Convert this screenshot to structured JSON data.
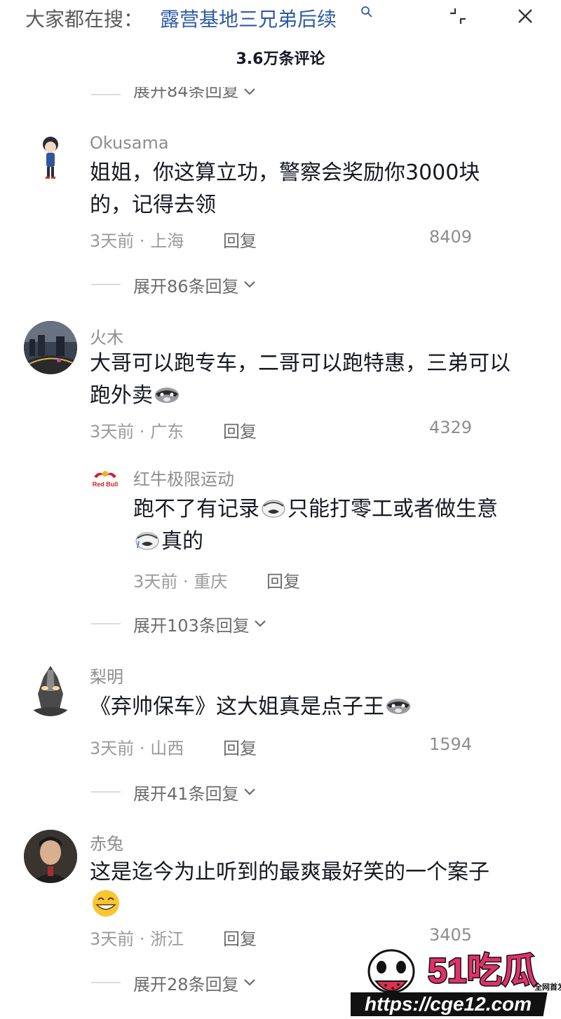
{
  "header": {
    "trend_prefix": "大家都在搜：",
    "trend_query": "露营基地三兄弟后续",
    "search_icon": "search-icon",
    "collapse_icon": "collapse-icon",
    "close_icon": "close-icon"
  },
  "comment_count_title": "3.6万条评论",
  "top_expand": {
    "label": "展开84条回复"
  },
  "comments": [
    {
      "username": "Okusama",
      "avatar": "cartoon-detective-avatar",
      "content_line1": "姐姐，你这算立功，警察会奖励你3000块",
      "content_line2": "的，记得去领",
      "time": "3天前",
      "location": "上海",
      "reply_label": "回复",
      "likes": "8409",
      "expand_label": "展开86条回复"
    },
    {
      "username": "火木",
      "avatar": "night-city-avatar",
      "content_line1": "大哥可以跑专车，二哥可以跑特惠，三弟可以",
      "content_line2": "跑外卖",
      "time": "3天前",
      "location": "广东",
      "reply_label": "回复",
      "likes": "4329",
      "reply": {
        "username": "红牛极限运动",
        "avatar": "redbull-logo-avatar",
        "logo_text": "Red Bull",
        "content_line1": "跑不了有记录",
        "content_line1b": "只能打零工或者做生意",
        "content_line2": "真的",
        "time": "3天前",
        "location": "重庆",
        "reply_label": "回复"
      },
      "expand_label": "展开103条回复"
    },
    {
      "username": "梨明",
      "avatar": "ultraman-avatar",
      "content_line1": "《弃帅保车》这大姐真是点子王",
      "time": "3天前",
      "location": "山西",
      "reply_label": "回复",
      "likes": "1594",
      "expand_label": "展开41条回复"
    },
    {
      "username": "赤兔",
      "avatar": "man-photo-avatar",
      "content_line1": "这是迄今为止听到的最爽最好笑的一个案子",
      "time": "3天前",
      "location": "浙江",
      "reply_label": "回复",
      "likes": "3405",
      "expand_label": "展开28条回复"
    }
  ],
  "meta_separator": "·",
  "watermark": {
    "brand": "51吃瓜",
    "tag": "全网首发",
    "url": "https://cge12.com"
  }
}
